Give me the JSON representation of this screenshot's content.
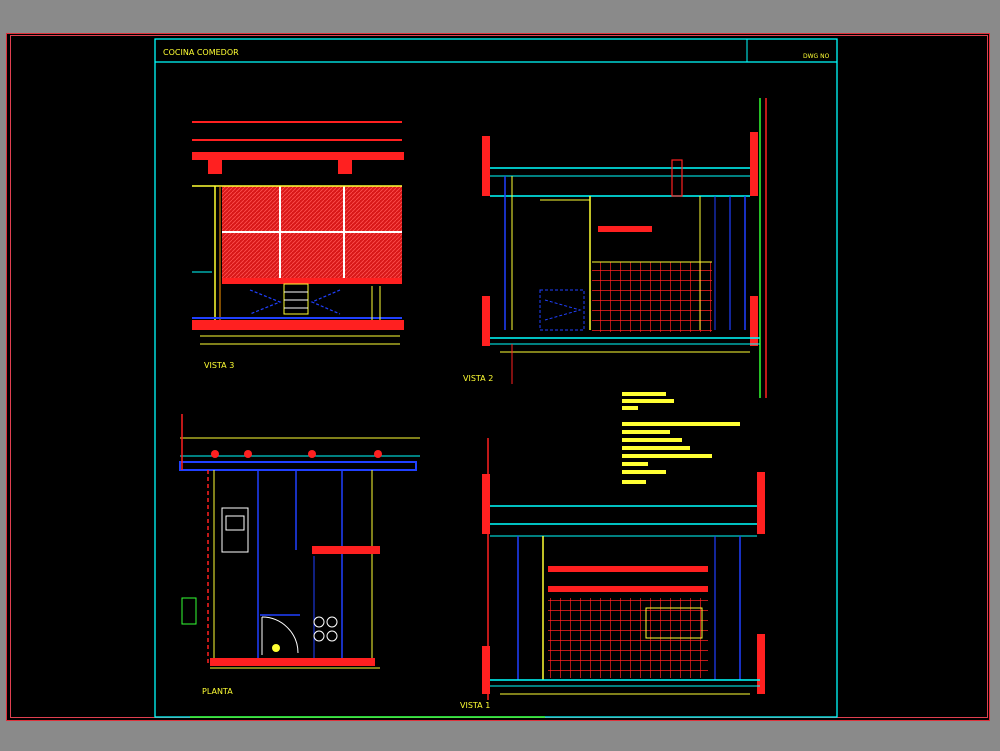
{
  "sheet": {
    "title": "COCINA COMEDOR",
    "sheet_no": "DWG NO"
  },
  "views": {
    "vista3": "VISTA 3",
    "vista2": "VISTA 2",
    "planta": "PLANTA",
    "vista1": "VISTA 1"
  },
  "colors": {
    "background": "#000000",
    "frame": "#00ffff",
    "hatch": "#ff2020",
    "dims": "#ffff33",
    "lines": "#2040ff",
    "text": "#ffff33"
  }
}
